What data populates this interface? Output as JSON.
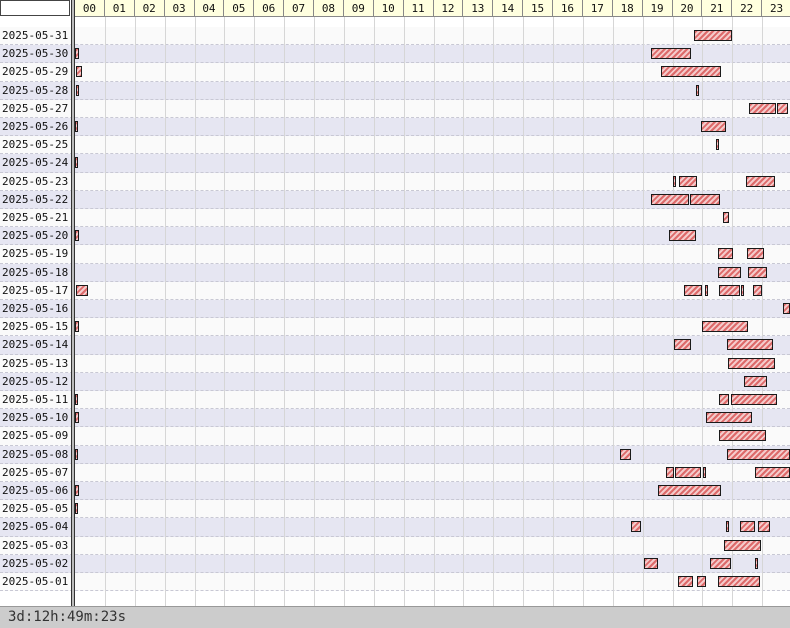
{
  "chart_data": {
    "type": "timeline",
    "x_unit": "hour of day",
    "xlim": [
      0,
      24
    ],
    "hour_labels": [
      "00",
      "01",
      "02",
      "03",
      "04",
      "05",
      "06",
      "07",
      "08",
      "09",
      "10",
      "11",
      "12",
      "13",
      "14",
      "15",
      "16",
      "17",
      "18",
      "19",
      "20",
      "21",
      "22",
      "23"
    ],
    "rows": [
      {
        "date": "2025-05-31",
        "segments": [
          [
            20.73,
            22.0
          ]
        ]
      },
      {
        "date": "2025-05-30",
        "segments": [
          [
            0.0,
            0.12
          ],
          [
            19.27,
            20.62
          ]
        ]
      },
      {
        "date": "2025-05-29",
        "segments": [
          [
            0.02,
            0.22
          ],
          [
            19.6,
            21.62
          ]
        ]
      },
      {
        "date": "2025-05-28",
        "segments": [
          [
            0.02,
            0.15
          ],
          [
            20.78,
            20.83
          ],
          [
            23.92,
            24.0
          ]
        ]
      },
      {
        "date": "2025-05-27",
        "segments": [
          [
            22.55,
            23.47
          ],
          [
            23.5,
            23.88
          ],
          [
            23.92,
            24.0
          ]
        ]
      },
      {
        "date": "2025-05-26",
        "segments": [
          [
            0.0,
            0.1
          ],
          [
            20.95,
            21.78
          ]
        ]
      },
      {
        "date": "2025-05-25",
        "segments": [
          [
            21.45,
            21.55
          ]
        ]
      },
      {
        "date": "2025-05-24",
        "segments": [
          [
            0.0,
            0.1
          ]
        ]
      },
      {
        "date": "2025-05-23",
        "segments": [
          [
            20.0,
            20.1
          ],
          [
            20.23,
            20.83
          ],
          [
            22.45,
            23.42
          ]
        ]
      },
      {
        "date": "2025-05-22",
        "segments": [
          [
            19.27,
            20.55
          ],
          [
            20.6,
            21.58
          ]
        ]
      },
      {
        "date": "2025-05-21",
        "segments": [
          [
            21.68,
            21.88
          ]
        ]
      },
      {
        "date": "2025-05-20",
        "segments": [
          [
            0.0,
            0.12
          ],
          [
            19.87,
            20.8
          ]
        ]
      },
      {
        "date": "2025-05-19",
        "segments": [
          [
            21.53,
            22.03
          ],
          [
            22.5,
            23.05
          ]
        ]
      },
      {
        "date": "2025-05-18",
        "segments": [
          [
            21.53,
            22.28
          ],
          [
            22.53,
            23.18
          ]
        ]
      },
      {
        "date": "2025-05-17",
        "segments": [
          [
            0.02,
            0.42
          ],
          [
            20.4,
            21.0
          ],
          [
            21.1,
            21.15
          ],
          [
            21.55,
            22.27
          ],
          [
            22.3,
            22.4
          ],
          [
            22.68,
            23.0
          ]
        ]
      },
      {
        "date": "2025-05-16",
        "segments": [
          [
            23.7,
            24.0
          ]
        ]
      },
      {
        "date": "2025-05-15",
        "segments": [
          [
            0.0,
            0.12
          ],
          [
            21.0,
            22.53
          ]
        ]
      },
      {
        "date": "2025-05-14",
        "segments": [
          [
            20.05,
            20.62
          ],
          [
            21.82,
            23.37
          ]
        ]
      },
      {
        "date": "2025-05-13",
        "segments": [
          [
            21.85,
            23.42
          ]
        ]
      },
      {
        "date": "2025-05-12",
        "segments": [
          [
            22.4,
            23.15
          ]
        ]
      },
      {
        "date": "2025-05-11",
        "segments": [
          [
            0.0,
            0.1
          ],
          [
            21.57,
            21.9
          ],
          [
            21.95,
            23.5
          ]
        ]
      },
      {
        "date": "2025-05-10",
        "segments": [
          [
            0.0,
            0.12
          ],
          [
            21.13,
            22.67
          ]
        ]
      },
      {
        "date": "2025-05-09",
        "segments": [
          [
            21.55,
            23.12
          ]
        ]
      },
      {
        "date": "2025-05-08",
        "segments": [
          [
            0.0,
            0.08
          ],
          [
            18.25,
            18.6
          ],
          [
            21.82,
            24.0
          ]
        ]
      },
      {
        "date": "2025-05-07",
        "segments": [
          [
            19.77,
            20.05
          ],
          [
            20.1,
            20.95
          ],
          [
            21.03,
            21.1
          ],
          [
            22.75,
            24.0
          ]
        ]
      },
      {
        "date": "2025-05-06",
        "segments": [
          [
            0.0,
            0.12
          ],
          [
            19.5,
            21.63
          ]
        ]
      },
      {
        "date": "2025-05-05",
        "segments": [
          [
            0.0,
            0.1
          ]
        ]
      },
      {
        "date": "2025-05-04",
        "segments": [
          [
            18.62,
            18.95
          ],
          [
            21.78,
            21.85
          ],
          [
            22.25,
            22.77
          ],
          [
            22.87,
            23.27
          ]
        ]
      },
      {
        "date": "2025-05-03",
        "segments": [
          [
            21.72,
            22.95
          ]
        ]
      },
      {
        "date": "2025-05-02",
        "segments": [
          [
            19.05,
            19.5
          ],
          [
            21.27,
            21.97
          ],
          [
            22.75,
            22.85
          ]
        ]
      },
      {
        "date": "2025-05-01",
        "segments": [
          [
            20.18,
            20.7
          ],
          [
            20.83,
            21.12
          ],
          [
            21.53,
            22.92
          ]
        ]
      }
    ]
  },
  "colors": {
    "bar_fill": "#dd6a6a",
    "bar_stripe": "#f4caca",
    "header_bg": "#ffffdf",
    "row_even": "#fafafa",
    "row_odd": "#e6e6f2",
    "footer_bg": "#cccccc"
  },
  "footer": {
    "total": "3d:12h:49m:23s"
  }
}
